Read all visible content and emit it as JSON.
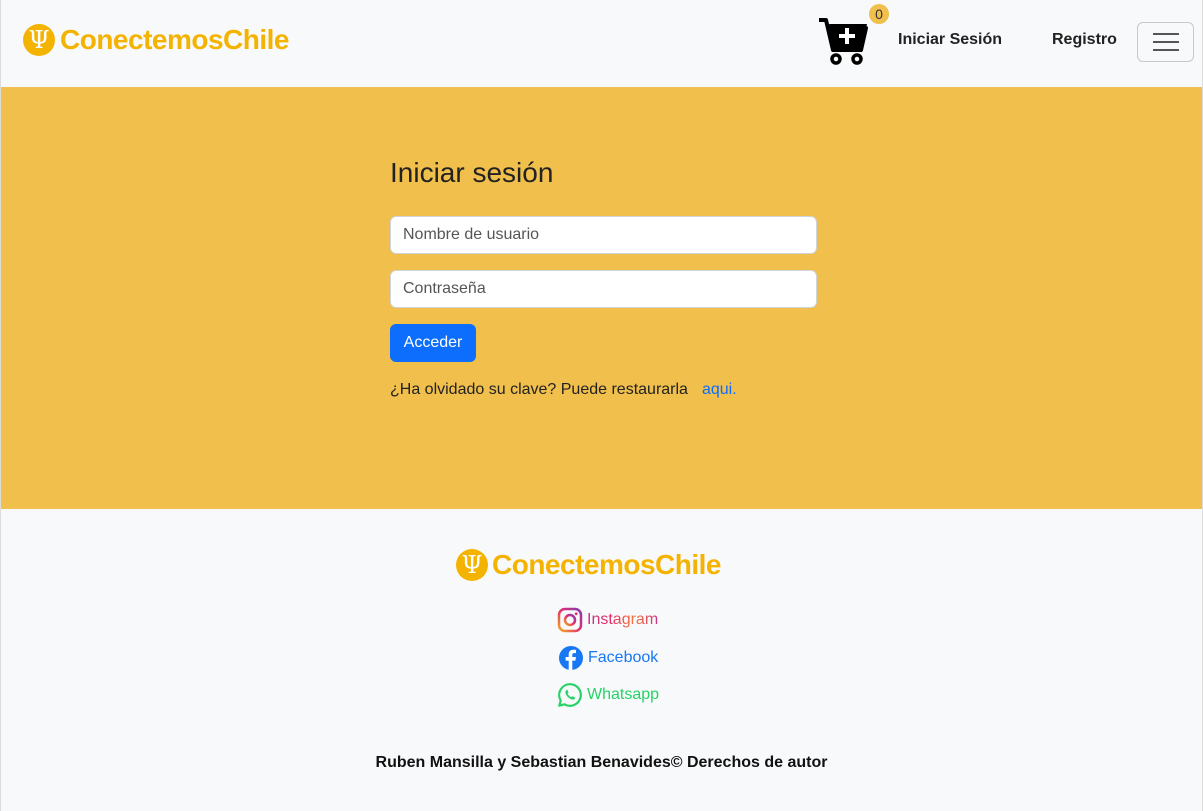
{
  "navbar": {
    "brand_name": "ConectemosChile",
    "brand_icon": "psi-logo-icon",
    "cart_count": "0",
    "login_label": "Iniciar Sesión",
    "register_label": "Registro"
  },
  "login": {
    "title": "Iniciar sesión",
    "username_placeholder": "Nombre de usuario",
    "password_placeholder": "Contraseña",
    "submit_label": "Acceder",
    "forgot_text": "¿Ha olvidado su clave? Puede restaurarla",
    "forgot_link": "aqui."
  },
  "footer": {
    "brand_name": "ConectemosChile",
    "social": [
      {
        "label": "Instagram",
        "icon": "instagram-icon"
      },
      {
        "label": "Facebook",
        "icon": "facebook-icon"
      },
      {
        "label": "Whatsapp",
        "icon": "whatsapp-icon"
      }
    ],
    "copyright": "Ruben Mansilla y Sebastian Benavides© Derechos de autor"
  },
  "colors": {
    "brand": "#f5b301",
    "main_bg": "#f0bf4c",
    "primary": "#0d6efd",
    "facebook": "#1877f2",
    "whatsapp": "#25d366"
  }
}
